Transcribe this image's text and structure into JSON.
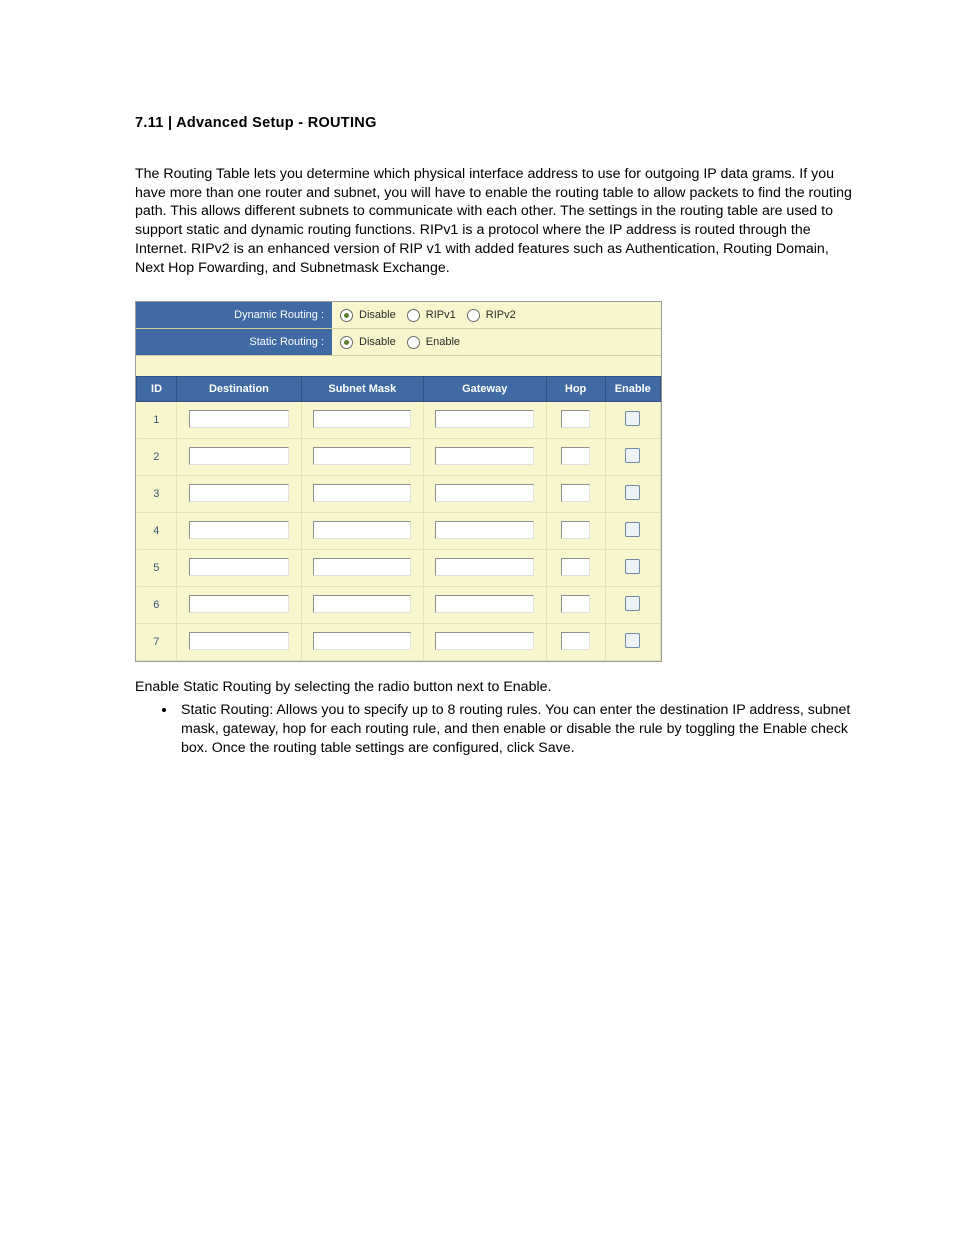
{
  "heading": "7.11 | Advanced Setup - ROUTING",
  "intro": "The Routing Table lets you determine which physical interface address to use for outgoing IP data grams. If you have more than one router and subnet, you will have to enable the routing table to allow packets to find the routing path. This allows different subnets to communicate with each other. The settings in the routing table are used to support static and dynamic routing functions. RIPv1 is a protocol where the IP address is routed through the Internet. RIPv2 is an enhanced version of RIP v1 with added features such as Authentication, Routing Domain, Next Hop Fowarding, and Subnetmask Exchange.",
  "panel": {
    "dynamic_label": "Dynamic Routing :",
    "dynamic_options": {
      "disable": "Disable",
      "ripv1": "RIPv1",
      "ripv2": "RIPv2",
      "selected": "disable"
    },
    "static_label": "Static Routing :",
    "static_options": {
      "disable": "Disable",
      "enable": "Enable",
      "selected": "disable"
    },
    "columns": {
      "id": "ID",
      "dest": "Destination",
      "mask": "Subnet Mask",
      "gw": "Gateway",
      "hop": "Hop",
      "enable": "Enable"
    },
    "rows": [
      {
        "id": "1",
        "dest": "",
        "mask": "",
        "gw": "",
        "hop": "",
        "enable": false
      },
      {
        "id": "2",
        "dest": "",
        "mask": "",
        "gw": "",
        "hop": "",
        "enable": false
      },
      {
        "id": "3",
        "dest": "",
        "mask": "",
        "gw": "",
        "hop": "",
        "enable": false
      },
      {
        "id": "4",
        "dest": "",
        "mask": "",
        "gw": "",
        "hop": "",
        "enable": false
      },
      {
        "id": "5",
        "dest": "",
        "mask": "",
        "gw": "",
        "hop": "",
        "enable": false
      },
      {
        "id": "6",
        "dest": "",
        "mask": "",
        "gw": "",
        "hop": "",
        "enable": false
      },
      {
        "id": "7",
        "dest": "",
        "mask": "",
        "gw": "",
        "hop": "",
        "enable": false
      }
    ]
  },
  "after_panel": "Enable Static Routing by selecting the radio button next to Enable.",
  "bullet": "Static Routing: Allows you to specify up to 8 routing rules. You can enter the destination IP address, subnet mask, gateway, hop for each routing rule, and then enable or disable the rule by toggling the Enable check box. Once the routing table settings are configured, click Save."
}
